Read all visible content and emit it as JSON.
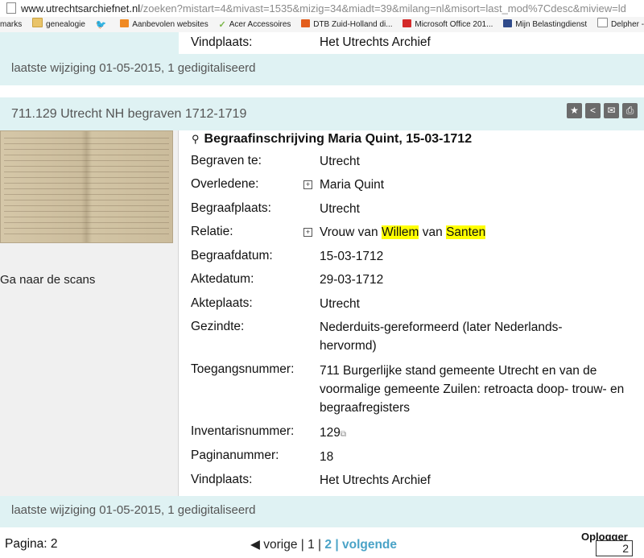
{
  "browser": {
    "url_host": "www.utrechtsarchiefnet.nl",
    "url_path": "/zoeken?mistart=4&mivast=1535&mizig=34&miadt=39&milang=nl&misort=last_mod%7Cdesc&miview=ld",
    "bookmarks": [
      "marks",
      "genealogie",
      "Aanbevolen websites",
      "Acer Accessoires",
      "DTB Zuid-Holland di...",
      "Microsoft Office 201...",
      "Mijn Belastingdienst",
      "Delpher - Boeken"
    ]
  },
  "previous_record": {
    "vindplaats_label": "Vindplaats:",
    "vindplaats_value": "Het Utrechts Archief",
    "status": "laatste wijziging 01-05-2015,  1 gedigitaliseerd"
  },
  "record": {
    "title": "711.129 Utrecht NH begraven 1712-1719",
    "scan_link": "Ga naar de scans",
    "heading_icon": "grave-icon",
    "heading": "Begraafinschrijving Maria Quint, 15-03-1712",
    "fields": {
      "begraven_te": {
        "label": "Begraven te:",
        "value": "Utrecht"
      },
      "overledene": {
        "label": "Overledene:",
        "value": "Maria Quint"
      },
      "begraafplaats": {
        "label": "Begraafplaats:",
        "value": "Utrecht"
      },
      "relatie": {
        "label": "Relatie:",
        "prefix": "Vrouw van",
        "first": "Willem",
        "middle": "van",
        "last": "Santen"
      },
      "begraafdatum": {
        "label": "Begraafdatum:",
        "value": "15-03-1712"
      },
      "aktedatum": {
        "label": "Aktedatum:",
        "value": "29-03-1712"
      },
      "akteplaats": {
        "label": "Akteplaats:",
        "value": "Utrecht"
      },
      "gezindte": {
        "label": "Gezindte:",
        "value": "Nederduits-gereformeerd (later Nederlands-hervormd)"
      },
      "toegangsnummer": {
        "label": "Toegangsnummer:",
        "value": "711 Burgerlijke stand gemeente Utrecht en van de voormalige gemeente Zuilen: retroacta doop- trouw- en begraafregisters"
      },
      "inventarisnummer": {
        "label": "Inventarisnummer:",
        "value": "129"
      },
      "paginanummer": {
        "label": "Paginanummer:",
        "value": "18"
      },
      "vindplaats": {
        "label": "Vindplaats:",
        "value": "Het Utrechts Archief"
      }
    },
    "status": "laatste wijziging 01-05-2015,  1 gedigitaliseerd",
    "tools": [
      "bookmark-icon",
      "share-icon",
      "email-icon",
      "print-icon"
    ]
  },
  "pager": {
    "label": "Pagina: 2",
    "prev": "vorige",
    "sep": "|",
    "page1": "1",
    "current": "2",
    "next": "volgende",
    "oplogger": "Oplogger",
    "page_input": "2"
  }
}
